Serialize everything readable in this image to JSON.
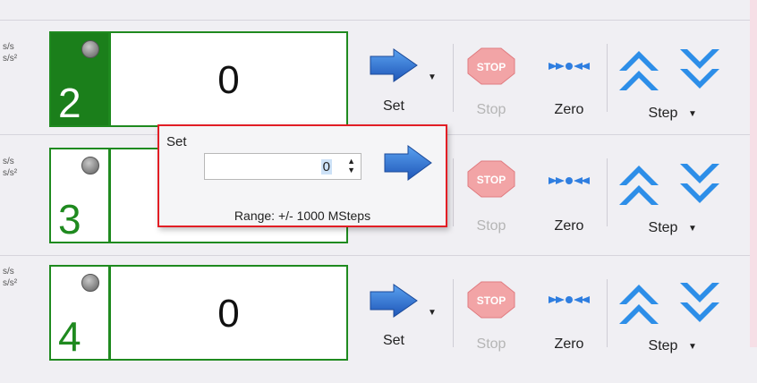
{
  "units": {
    "velocity": "s/s",
    "acceleration": "s/s²"
  },
  "channels": [
    {
      "number": "2",
      "value": "0",
      "active": true
    },
    {
      "number": "3",
      "value": "",
      "active": false
    },
    {
      "number": "4",
      "value": "0",
      "active": false
    }
  ],
  "toolbar": {
    "set_label": "Set",
    "stop_label": "Stop",
    "stop_icon_text": "STOP",
    "zero_label": "Zero",
    "step_label": "Step"
  },
  "set_popup": {
    "title": "Set",
    "input_value": "0",
    "range_text": "Range: +/- 1000 MSteps"
  },
  "colors": {
    "active_green": "#1b7f1b",
    "border_green": "#1f8a1f",
    "popup_border": "#e21e25",
    "arrow_blue": "#1f6fd1"
  }
}
